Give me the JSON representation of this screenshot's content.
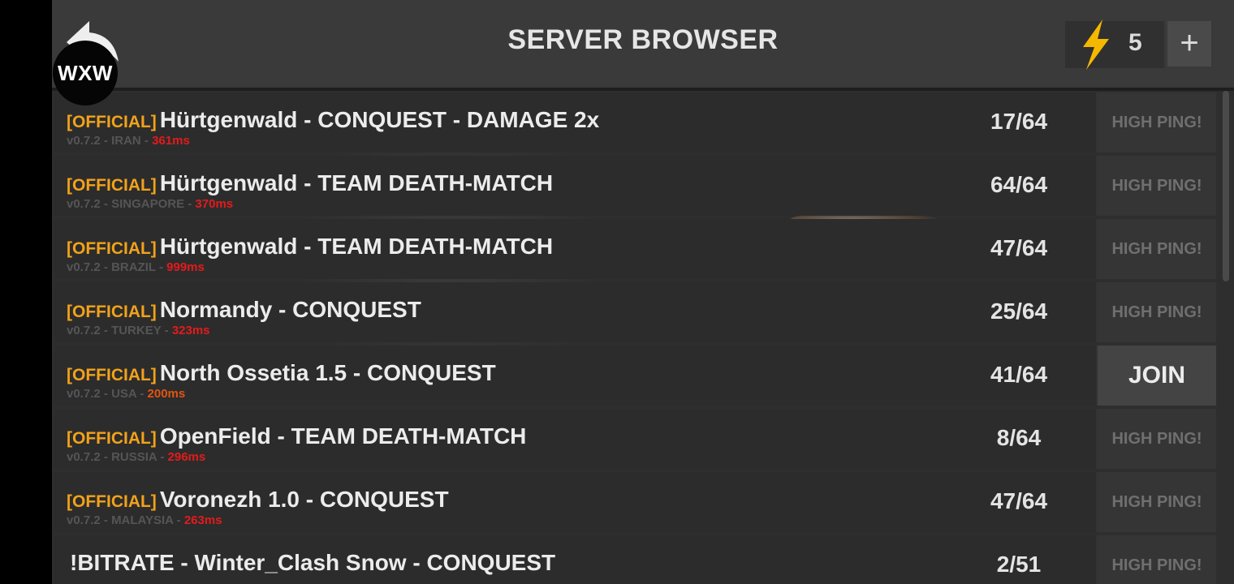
{
  "header": {
    "title": "SERVER BROWSER",
    "energy_count": "5",
    "plus_label": "+",
    "overlay_badge": "WXW"
  },
  "colors": {
    "official_tag": "#f2a21a",
    "ping_high": "#e31b1b",
    "ping_ok": "#e25410",
    "energy_icon": "#f5b800"
  },
  "icons": [
    "back-arrow-icon",
    "lightning-bolt-icon"
  ],
  "servers": [
    {
      "tag": "[OFFICIAL]",
      "name": "Hürtgenwald - CONQUEST - DAMAGE 2x",
      "version": "v0.7.2",
      "region": "IRAN",
      "ping": "361ms",
      "players": "17/64",
      "action": "HIGH PING!"
    },
    {
      "tag": "[OFFICIAL]",
      "name": "Hürtgenwald - TEAM DEATH-MATCH",
      "version": "v0.7.2",
      "region": "SINGAPORE",
      "ping": "370ms",
      "players": "64/64",
      "action": "HIGH PING!"
    },
    {
      "tag": "[OFFICIAL]",
      "name": "Hürtgenwald - TEAM DEATH-MATCH",
      "version": "v0.7.2",
      "region": "BRAZIL",
      "ping": "999ms",
      "players": "47/64",
      "action": "HIGH PING!"
    },
    {
      "tag": "[OFFICIAL]",
      "name": "Normandy - CONQUEST",
      "version": "v0.7.2",
      "region": "TURKEY",
      "ping": "323ms",
      "players": "25/64",
      "action": "HIGH PING!"
    },
    {
      "tag": "[OFFICIAL]",
      "name": "North Ossetia 1.5 - CONQUEST",
      "version": "v0.7.2",
      "region": "USA",
      "ping": "200ms",
      "players": "41/64",
      "action": "JOIN"
    },
    {
      "tag": "[OFFICIAL]",
      "name": "OpenField - TEAM DEATH-MATCH",
      "version": "v0.7.2",
      "region": "RUSSIA",
      "ping": "296ms",
      "players": "8/64",
      "action": "HIGH PING!"
    },
    {
      "tag": "[OFFICIAL]",
      "name": "Voronezh 1.0 - CONQUEST",
      "version": "v0.7.2",
      "region": "MALAYSIA",
      "ping": "263ms",
      "players": "47/64",
      "action": "HIGH PING!"
    },
    {
      "tag": "",
      "name": "!BITRATE - Winter_Clash Snow - CONQUEST",
      "version": "",
      "region": "",
      "ping": "",
      "players": "2/51",
      "action": "HIGH PING!"
    }
  ]
}
